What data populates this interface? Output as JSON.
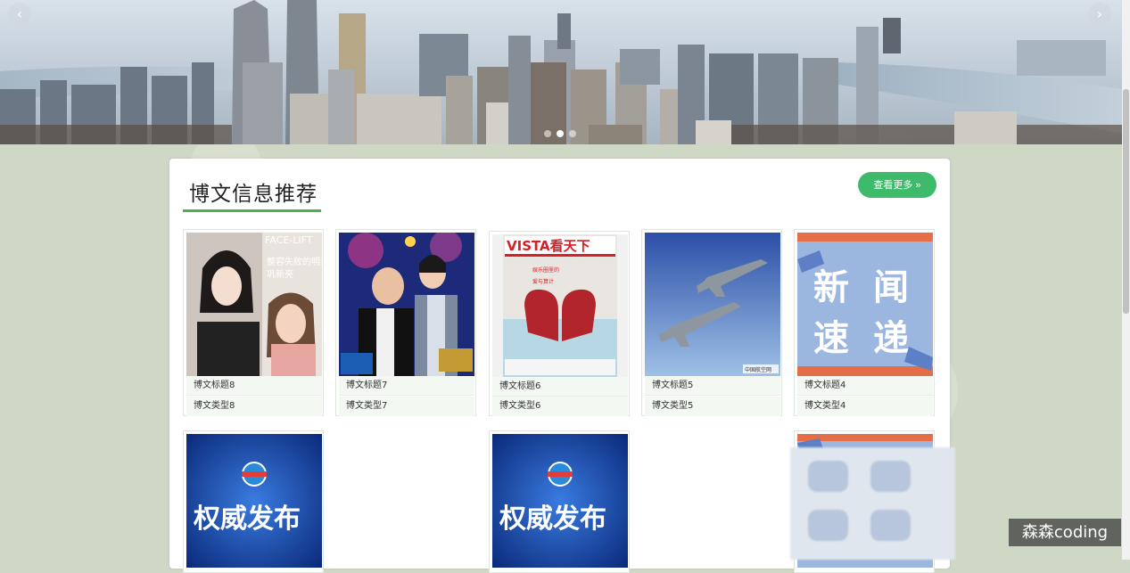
{
  "banner": {
    "prev_icon": "chevron-left-icon",
    "next_icon": "chevron-right-icon",
    "slides": 3,
    "active_slide": 1
  },
  "section": {
    "title": "博文信息推荐",
    "more_label": "查看更多 »",
    "accent_color": "#4caf50",
    "button_color": "#3dbb6b"
  },
  "cards": [
    {
      "title": "博文标题8",
      "type": "博文类型8",
      "image": "portrait-women",
      "caption": "整容失败的明星 巩新亮",
      "caption_top": "FACE-LIFT"
    },
    {
      "title": "博文标题7",
      "type": "博文类型7",
      "image": "stage-two-men"
    },
    {
      "title": "博文标题6",
      "type": "博文类型6",
      "image": "magazine-heart",
      "caption": "VISTA看天下"
    },
    {
      "title": "博文标题5",
      "type": "博文类型5",
      "image": "fighter-jets",
      "caption": "中国航空网"
    },
    {
      "title": "博文标题4",
      "type": "博文类型4",
      "image": "news-express",
      "caption": "新闻速递"
    }
  ],
  "second_row": [
    {
      "image": "authority-release",
      "caption": "权威发布"
    },
    {
      "image": "authority-release",
      "caption": "权威发布"
    },
    {
      "image": "news-express-partial"
    }
  ],
  "watermark": "森森coding"
}
